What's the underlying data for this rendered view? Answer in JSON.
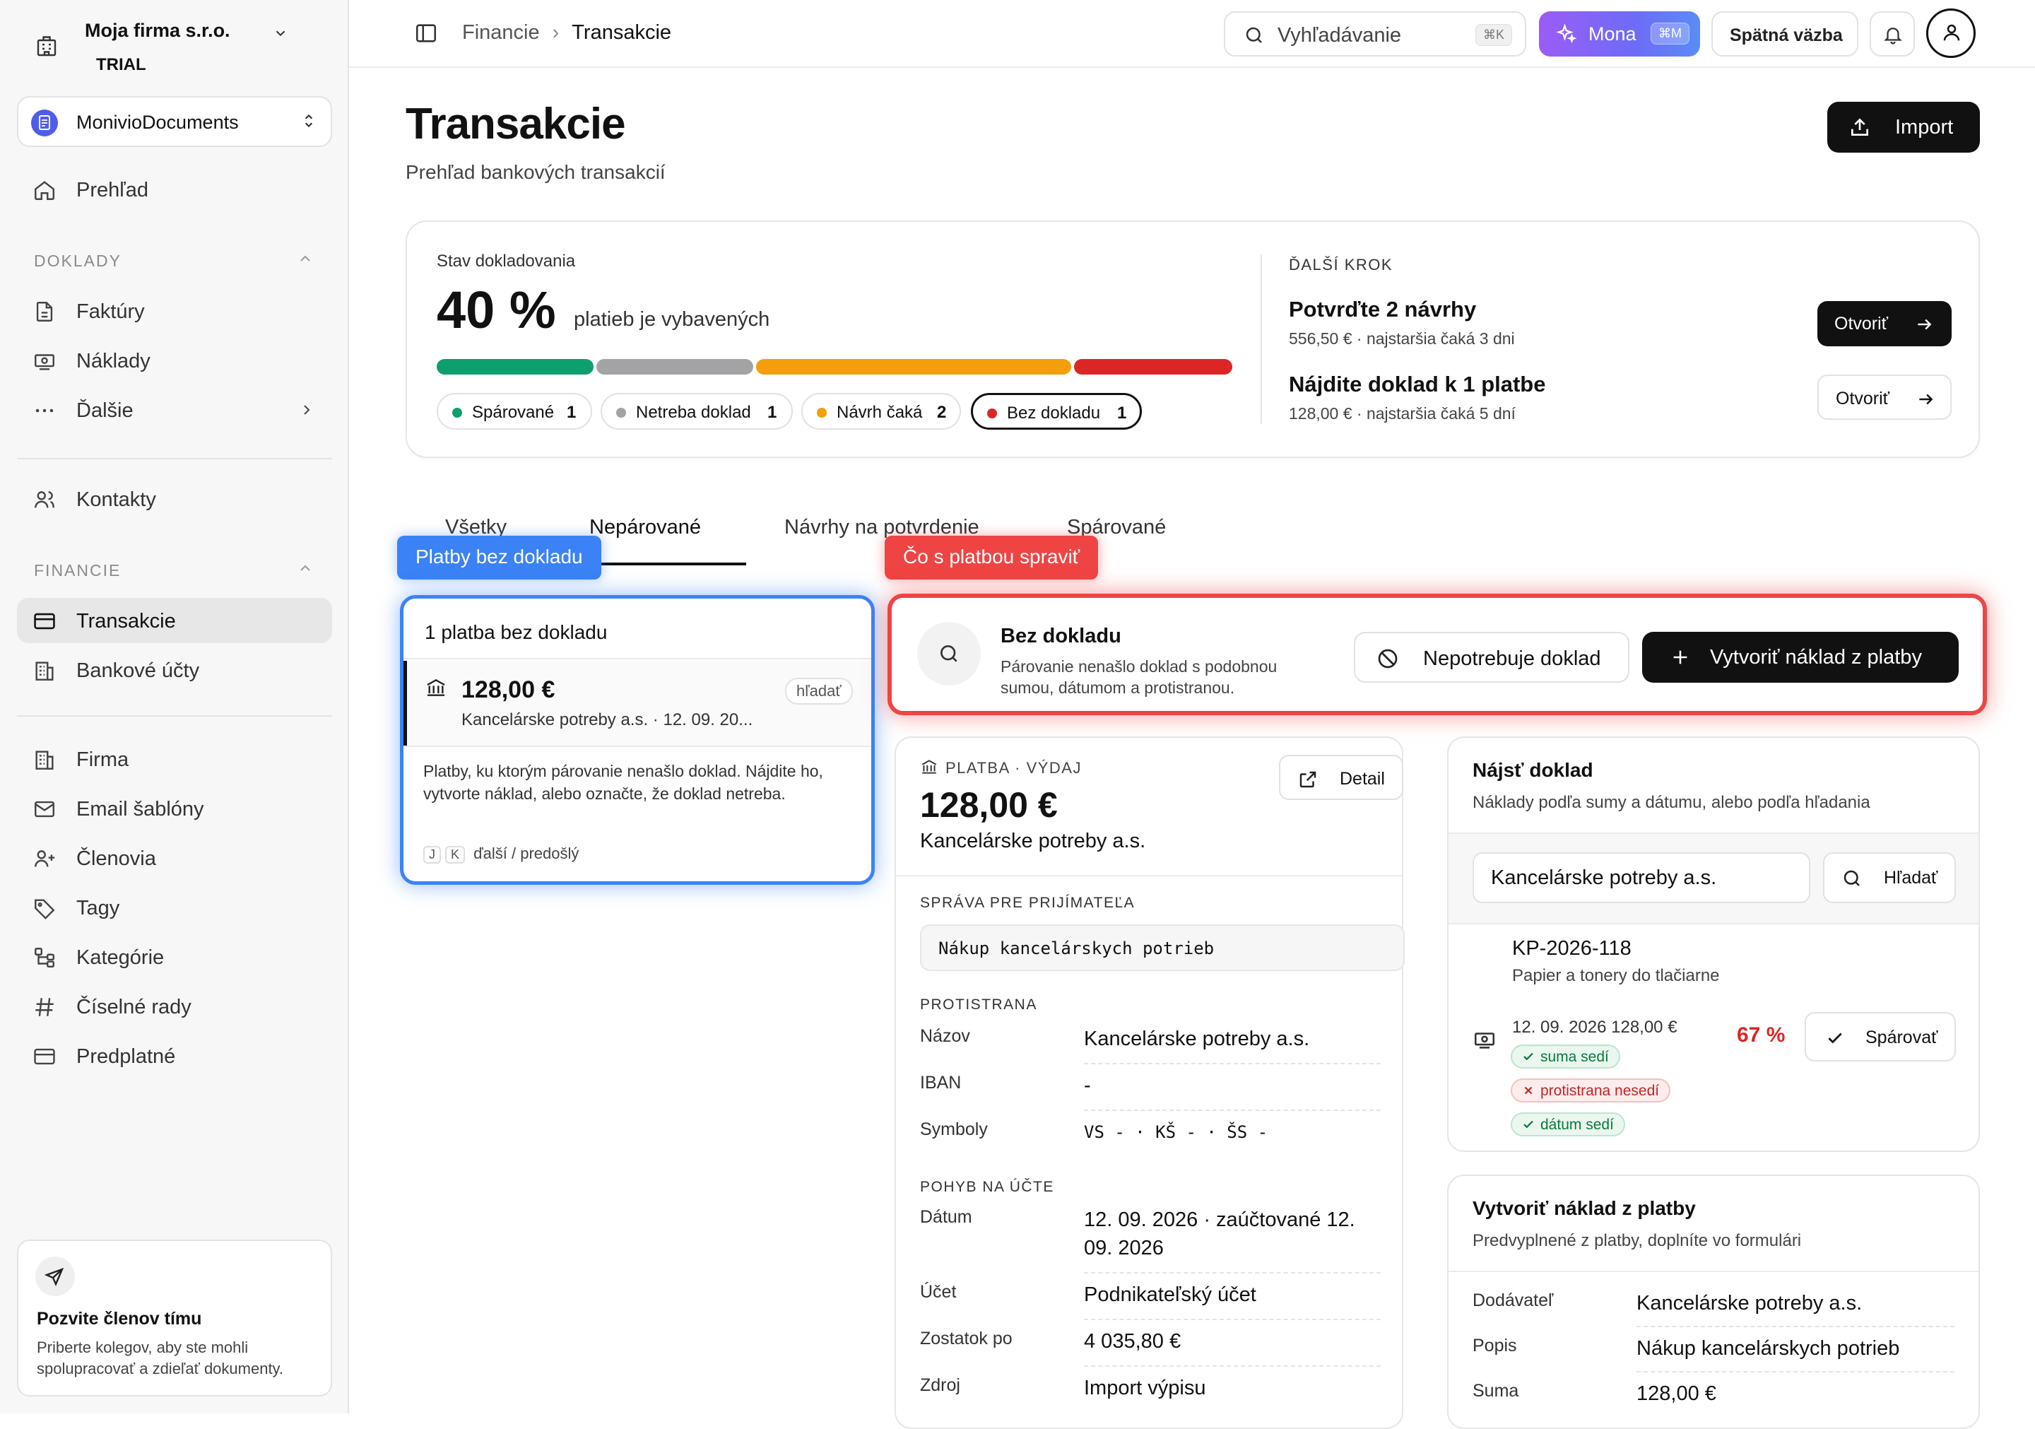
{
  "sidebar": {
    "company_name": "Moja firma s.r.o.",
    "plan": "TRIAL",
    "workspace": "MonivioDocuments",
    "overview": "Prehľad",
    "section_documents": "DOKLADY",
    "invoices": "Faktúry",
    "expenses": "Náklady",
    "more": "Ďalšie",
    "contacts": "Kontakty",
    "section_finance": "FINANCIE",
    "transactions": "Transakcie",
    "bank_accounts": "Bankové účty",
    "company": "Firma",
    "email_templates": "Email šablóny",
    "members": "Členovia",
    "tags": "Tagy",
    "categories": "Kategórie",
    "number_series": "Číselné rady",
    "subscription": "Predplatné",
    "invite_title": "Pozvite členov tímu",
    "invite_desc": "Priberte kolegov, aby ste mohli spolupracovať a zdieľať dokumenty."
  },
  "topbar": {
    "breadcrumb_parent": "Financie",
    "breadcrumb_current": "Transakcie",
    "search_placeholder": "Vyhľadávanie",
    "search_shortcut": "⌘K",
    "mona_label": "Mona",
    "mona_shortcut": "⌘M",
    "feedback": "Spätná väzba"
  },
  "page": {
    "title": "Transakcie",
    "subtitle": "Prehľad bankových transakcií",
    "import_label": "Import"
  },
  "status": {
    "label": "Stav dokladovania",
    "percent": "40 %",
    "percent_text": "platieb je vybavených",
    "colors": {
      "paired": "#0e9f6e",
      "not_needed": "#a3a3a6",
      "waiting": "#f59e0b",
      "missing": "#dc2626"
    },
    "chips": [
      {
        "label": "Spárované",
        "count": "1"
      },
      {
        "label": "Netreba doklad",
        "count": "1"
      },
      {
        "label": "Návrh čaká",
        "count": "2"
      },
      {
        "label": "Bez dokladu",
        "count": "1"
      }
    ],
    "next_heading": "ĎALŠÍ KROK",
    "next_items": [
      {
        "title": "Potvrďte 2 návrhy",
        "sub": "556,50 € · najstaršia čaká 3 dni",
        "button": "Otvoriť"
      },
      {
        "title": "Nájdite doklad k 1 platbe",
        "sub": "128,00 € · najstaršia čaká 5 dní",
        "button": "Otvoriť"
      }
    ]
  },
  "tabs": [
    "Všetky",
    "Nepárované",
    "Návrhy na potvrdenie",
    "Spárované"
  ],
  "callouts": {
    "left": "Platby bez dokladu",
    "right": "Čo s platbou spraviť"
  },
  "unmatched": {
    "header": "1 platba bez dokladu",
    "amount": "128,00 €",
    "sub": "Kancelárske potreby a.s. · 12. 09. 20...",
    "tag": "hľadať",
    "description": "Platby, ku ktorým párovanie nenašlo doklad. Nájdite ho, vytvorte náklad, alebo označte, že doklad netreba.",
    "key_j": "J",
    "key_k": "K",
    "key_hint": "ďalší / predošlý"
  },
  "action": {
    "title": "Bez dokladu",
    "description": "Párovanie nenašlo doklad s podobnou sumou, dátumom a protistranou.",
    "not_needed": "Nepotrebuje doklad",
    "create": "Vytvoriť náklad z platby"
  },
  "payment": {
    "kind": "PLATBA · VÝDAJ",
    "amount": "128,00 €",
    "counterparty": "Kancelárske potreby a.s.",
    "detail_button": "Detail",
    "message_heading": "SPRÁVA PRE PRIJÍMATEĽA",
    "message": "Nákup kancelárskych potrieb",
    "cp_heading": "PROTISTRANA",
    "name_label": "Názov",
    "name_value": "Kancelárske potreby a.s.",
    "iban_label": "IBAN",
    "iban_value": "-",
    "symbols_label": "Symboly",
    "symbols_value": "VS - · KŠ - · ŠS -",
    "movement_heading": "POHYB NA ÚČTE",
    "date_label": "Dátum",
    "date_value": "12. 09. 2026 · zaúčtované 12. 09. 2026",
    "account_label": "Účet",
    "account_value": "Podnikateľský účet",
    "balance_label": "Zostatok po",
    "balance_value": "4 035,80 €",
    "source_label": "Zdroj",
    "source_value": "Import výpisu"
  },
  "find": {
    "title": "Nájsť doklad",
    "description": "Náklady podľa sumy a dátumu, alebo podľa hľadania",
    "query": "Kancelárske potreby a.s.",
    "search_button": "Hľadať",
    "candidate_code": "KP-2026-118",
    "candidate_desc": "Papier a tonery do tlačiarne",
    "candidate_date_amount": "12. 09. 2026  128,00 €",
    "checks": [
      {
        "label": "suma sedí",
        "ok": true
      },
      {
        "label": "protistrana nesedí",
        "ok": false
      },
      {
        "label": "dátum sedí",
        "ok": true
      }
    ],
    "score": "67 %",
    "pair_button": "Spárovať"
  },
  "create": {
    "title": "Vytvoriť náklad z platby",
    "description": "Predvyplnené z platby, doplníte vo formulári",
    "supplier_label": "Dodávateľ",
    "supplier_value": "Kancelárske potreby a.s.",
    "desc_label": "Popis",
    "desc_value": "Nákup kancelárskych potrieb",
    "sum_label": "Suma",
    "sum_value": "128,00 €"
  }
}
